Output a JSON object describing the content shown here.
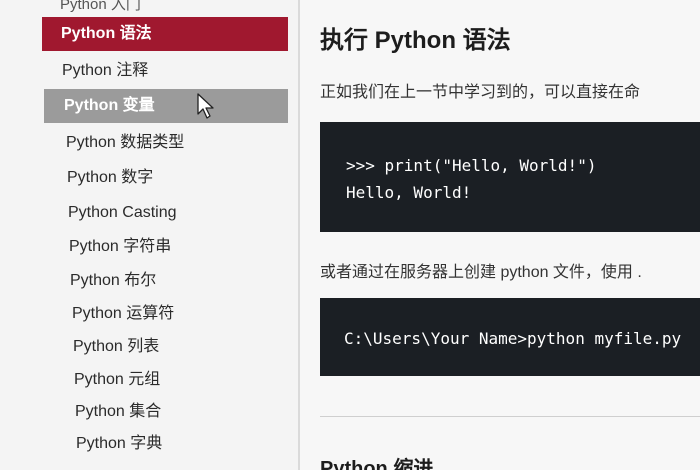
{
  "sidebar": {
    "items": [
      {
        "label": "Python 入门"
      },
      {
        "label": "Python 语法"
      },
      {
        "label": "Python 注释"
      },
      {
        "label": "Python 变量"
      },
      {
        "label": "Python 数据类型"
      },
      {
        "label": "Python 数字"
      },
      {
        "label": "Python Casting"
      },
      {
        "label": "Python 字符串"
      },
      {
        "label": "Python 布尔"
      },
      {
        "label": "Python 运算符"
      },
      {
        "label": "Python 列表"
      },
      {
        "label": "Python 元组"
      },
      {
        "label": "Python 集合"
      },
      {
        "label": "Python 字典"
      }
    ],
    "active_index": 1,
    "hover_index": 3,
    "active_color": "#a0182f"
  },
  "main": {
    "title": "执行 Python 语法",
    "intro": "正如我们在上一节中学习到的，可以直接在命",
    "code_block_1": {
      "line1": ">>> print(\"Hello, World!\")",
      "line2": "Hello, World!"
    },
    "para2": "或者通过在服务器上创建 python 文件，使用 .",
    "code_block_2": {
      "line1": "C:\\Users\\Your Name>python myfile.py"
    },
    "next_heading": "Python 缩进"
  }
}
